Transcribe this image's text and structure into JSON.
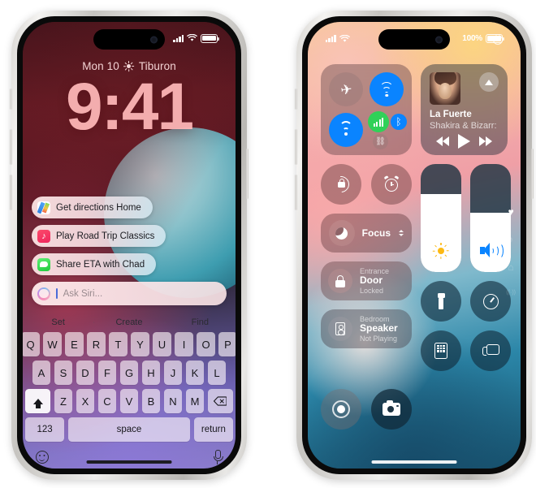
{
  "lock_screen": {
    "status_bar": {
      "signal_icon": "cellular-bars-icon",
      "wifi_icon": "wifi-icon",
      "battery_icon": "battery-icon"
    },
    "date_line": "Mon 10",
    "weather_icon": "sunny-icon",
    "location": "Tiburon",
    "time": "9:41",
    "siri_suggestions": [
      {
        "icon": "maps-app-icon",
        "label": "Get directions Home"
      },
      {
        "icon": "music-app-icon",
        "label": "Play Road Trip Classics"
      },
      {
        "icon": "messages-app-icon",
        "label": "Share ETA with Chad"
      }
    ],
    "ask_siri": {
      "icon": "siri-orb-icon",
      "placeholder": "Ask Siri...",
      "value": ""
    },
    "keyboard": {
      "suggestions": [
        "Set",
        "Create",
        "Find"
      ],
      "row1": [
        "Q",
        "W",
        "E",
        "R",
        "T",
        "Y",
        "U",
        "I",
        "O",
        "P"
      ],
      "row2": [
        "A",
        "S",
        "D",
        "F",
        "G",
        "H",
        "J",
        "K",
        "L"
      ],
      "row3": [
        "Z",
        "X",
        "C",
        "V",
        "B",
        "N",
        "M"
      ],
      "shift_icon": "shift-arrow-icon",
      "delete_icon": "backspace-icon",
      "numbers_key": "123",
      "space_key": "space",
      "return_key": "return",
      "emoji_icon": "emoji-smiley-icon",
      "dictation_icon": "microphone-icon"
    }
  },
  "control_center": {
    "status_bar": {
      "signal_icon": "cellular-bars-icon",
      "wifi_icon": "wifi-icon",
      "battery_percent": "100%",
      "battery_icon": "battery-icon"
    },
    "power_icon": "power-icon",
    "connectivity": {
      "airplane": {
        "icon": "airplane-icon",
        "state": "off"
      },
      "airdrop": {
        "icon": "airdrop-icon",
        "state": "on"
      },
      "wifi": {
        "icon": "wifi-icon",
        "state": "on"
      },
      "cellular": {
        "icon": "cellular-bars-icon",
        "state": "on"
      },
      "bluetooth": {
        "icon": "bluetooth-icon",
        "state": "on"
      },
      "hotspot": {
        "icon": "personal-hotspot-icon",
        "state": "off"
      }
    },
    "now_playing": {
      "artwork_icon": "album-artwork",
      "airplay_icon": "airplay-icon",
      "title": "La Fuerte",
      "artist": "Shakira & Bizarr:",
      "previous_icon": "rewind-icon",
      "play_icon": "play-icon",
      "next_icon": "fast-forward-icon"
    },
    "rotation_lock": {
      "icon": "rotation-lock-icon"
    },
    "timer_alarm": {
      "icon": "alarm-clock-icon"
    },
    "focus": {
      "icon": "moon-icon",
      "label": "Focus",
      "chevron_icon": "chevron-expand-icon"
    },
    "home_tiles": [
      {
        "icon": "lock-icon",
        "room": "Entrance",
        "name": "Door",
        "status": "Locked"
      },
      {
        "icon": "speaker-icon",
        "room": "Bedroom",
        "name": "Speaker",
        "status": "Not Playing"
      }
    ],
    "sliders": {
      "brightness": {
        "icon": "brightness-sun-icon",
        "value": 72
      },
      "volume": {
        "icon": "volume-speaker-icon",
        "value": 55
      }
    },
    "utilities": [
      {
        "icon": "flashlight-icon"
      },
      {
        "icon": "timer-icon"
      },
      {
        "icon": "calculator-icon"
      },
      {
        "icon": "screen-mirroring-icon"
      }
    ],
    "bottom_controls": [
      {
        "icon": "screen-record-icon"
      },
      {
        "icon": "camera-icon"
      }
    ],
    "page_indicators": [
      {
        "icon": "heart-icon",
        "glyph": "♥",
        "active": true
      },
      {
        "icon": "music-note-icon",
        "glyph": "♪",
        "active": false
      },
      {
        "icon": "home-icon",
        "glyph": "⌂",
        "active": false
      },
      {
        "icon": "connectivity-icon",
        "glyph": "((·))",
        "active": false
      }
    ]
  }
}
